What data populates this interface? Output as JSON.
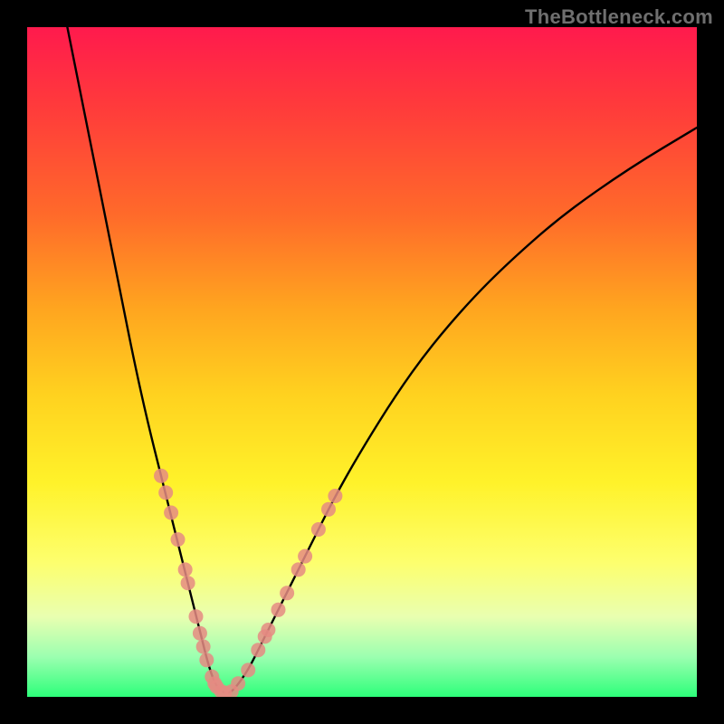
{
  "watermark": "TheBottleneck.com",
  "chart_data": {
    "type": "line",
    "title": "",
    "xlabel": "",
    "ylabel": "",
    "xlim": [
      0,
      100
    ],
    "ylim": [
      0,
      100
    ],
    "grid": false,
    "legend": false,
    "series": [
      {
        "name": "bottleneck-curve",
        "x": [
          6,
          8,
          10,
          12,
          14,
          16,
          18,
          20,
          22,
          24,
          25,
          26,
          27,
          28,
          29,
          30,
          31,
          33,
          35,
          38,
          42,
          46,
          50,
          55,
          60,
          66,
          72,
          80,
          90,
          100
        ],
        "values": [
          100,
          90,
          80,
          70,
          60,
          50,
          41,
          33,
          25,
          17,
          13,
          9,
          5,
          2,
          0.8,
          0.5,
          1.2,
          4,
          8,
          14,
          22,
          30,
          37,
          45,
          52,
          59,
          65,
          72,
          79,
          85
        ]
      }
    ],
    "markers": {
      "name": "sample-points",
      "color": "#e58b82",
      "points": [
        {
          "x": 20.0,
          "y": 33.0
        },
        {
          "x": 20.7,
          "y": 30.5
        },
        {
          "x": 21.5,
          "y": 27.5
        },
        {
          "x": 22.5,
          "y": 23.5
        },
        {
          "x": 23.6,
          "y": 19.0
        },
        {
          "x": 24.0,
          "y": 17.0
        },
        {
          "x": 25.2,
          "y": 12.0
        },
        {
          "x": 25.8,
          "y": 9.5
        },
        {
          "x": 26.3,
          "y": 7.5
        },
        {
          "x": 26.8,
          "y": 5.5
        },
        {
          "x": 27.6,
          "y": 3.0
        },
        {
          "x": 28.0,
          "y": 2.0
        },
        {
          "x": 28.3,
          "y": 1.5
        },
        {
          "x": 29.0,
          "y": 0.8
        },
        {
          "x": 29.5,
          "y": 0.6
        },
        {
          "x": 30.5,
          "y": 0.8
        },
        {
          "x": 31.5,
          "y": 2.0
        },
        {
          "x": 33.0,
          "y": 4.0
        },
        {
          "x": 34.5,
          "y": 7.0
        },
        {
          "x": 35.5,
          "y": 9.0
        },
        {
          "x": 36.0,
          "y": 10.0
        },
        {
          "x": 37.5,
          "y": 13.0
        },
        {
          "x": 38.8,
          "y": 15.5
        },
        {
          "x": 40.5,
          "y": 19.0
        },
        {
          "x": 41.5,
          "y": 21.0
        },
        {
          "x": 43.5,
          "y": 25.0
        },
        {
          "x": 45.0,
          "y": 28.0
        },
        {
          "x": 46.0,
          "y": 30.0
        }
      ]
    }
  }
}
